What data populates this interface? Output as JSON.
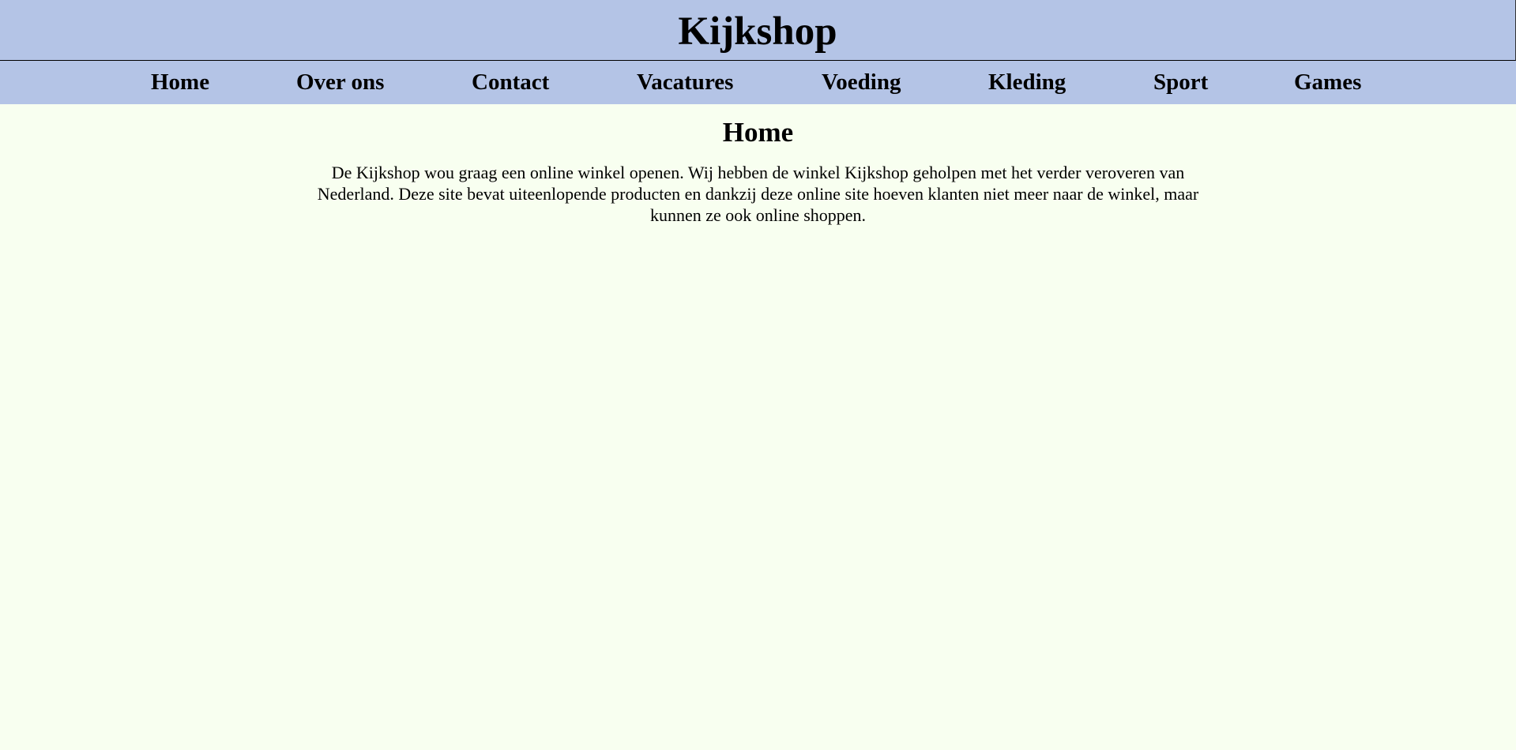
{
  "header": {
    "title": "Kijkshop"
  },
  "nav": {
    "items": [
      {
        "label": "Home"
      },
      {
        "label": "Over ons"
      },
      {
        "label": "Contact"
      },
      {
        "label": "Vacatures"
      },
      {
        "label": "Voeding"
      },
      {
        "label": "Kleding"
      },
      {
        "label": "Sport"
      },
      {
        "label": "Games"
      }
    ]
  },
  "main": {
    "heading": "Home",
    "paragraph": "De Kijkshop wou graag een online winkel openen. Wij hebben de winkel  Kijkshop geholpen met het verder veroveren van Nederland.  Deze site bevat uiteenlopende producten en dankzij deze online site hoeven klanten niet meer naar de winkel, maar kunnen ze ook online shoppen."
  },
  "colors": {
    "header_background": "#b4c4e6",
    "page_background": "#f8fff0",
    "text": "#000000"
  }
}
